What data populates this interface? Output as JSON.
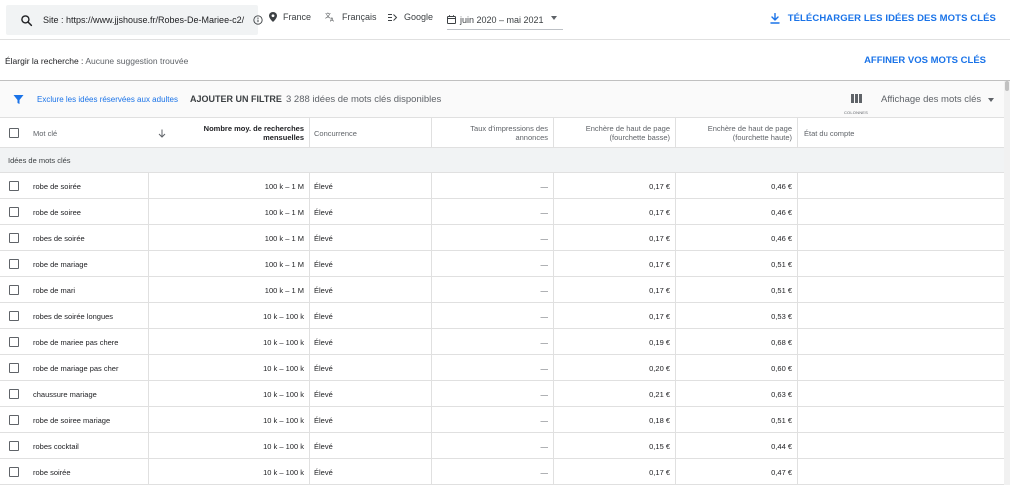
{
  "topbar": {
    "site": "Site : https://www.jjshouse.fr/Robes-De-Mariee-c2/",
    "location": "France",
    "language": "Français",
    "network": "Google",
    "date_range": "juin 2020 – mai 2021",
    "download_label": "TÉLÉCHARGER LES IDÉES DES MOTS CLÉS"
  },
  "broaden": {
    "label": "Élargir la recherche :",
    "value": "Aucune suggestion trouvée",
    "refine_label": "AFFINER VOS MOTS CLÉS"
  },
  "filterbar": {
    "exclude_label": "Exclure les idées réservées aux adultes",
    "add_filter_label": "AJOUTER UN FILTRE",
    "count_label": "3 288 idées de mots clés disponibles",
    "columns_label": "COLONNES",
    "display_label": "Affichage des mots clés"
  },
  "table": {
    "headers": {
      "keyword": "Mot clé",
      "searches": "Nombre moy. de recherches mensuelles",
      "competition": "Concurrence",
      "impressions": "Taux d'impressions des annonces",
      "bid_low": "Enchère de haut de page (fourchette basse)",
      "bid_high": "Enchère de haut de page (fourchette haute)",
      "account": "État du compte"
    },
    "group_label": "Idées de mots clés",
    "rows": [
      {
        "keyword": "robe de soirée",
        "searches": "100 k – 1 M",
        "competition": "Élevé",
        "impressions": "—",
        "bid_low": "0,17 €",
        "bid_high": "0,46 €"
      },
      {
        "keyword": "robe de soiree",
        "searches": "100 k – 1 M",
        "competition": "Élevé",
        "impressions": "—",
        "bid_low": "0,17 €",
        "bid_high": "0,46 €"
      },
      {
        "keyword": "robes de soirée",
        "searches": "100 k – 1 M",
        "competition": "Élevé",
        "impressions": "—",
        "bid_low": "0,17 €",
        "bid_high": "0,46 €"
      },
      {
        "keyword": "robe de mariage",
        "searches": "100 k – 1 M",
        "competition": "Élevé",
        "impressions": "—",
        "bid_low": "0,17 €",
        "bid_high": "0,51 €"
      },
      {
        "keyword": "robe de mari",
        "searches": "100 k – 1 M",
        "competition": "Élevé",
        "impressions": "—",
        "bid_low": "0,17 €",
        "bid_high": "0,51 €"
      },
      {
        "keyword": "robes de soirée longues",
        "searches": "10 k – 100 k",
        "competition": "Élevé",
        "impressions": "—",
        "bid_low": "0,17 €",
        "bid_high": "0,53 €"
      },
      {
        "keyword": "robe de mariee pas chere",
        "searches": "10 k – 100 k",
        "competition": "Élevé",
        "impressions": "—",
        "bid_low": "0,19 €",
        "bid_high": "0,68 €"
      },
      {
        "keyword": "robe de mariage pas cher",
        "searches": "10 k – 100 k",
        "competition": "Élevé",
        "impressions": "—",
        "bid_low": "0,20 €",
        "bid_high": "0,60 €"
      },
      {
        "keyword": "chaussure mariage",
        "searches": "10 k – 100 k",
        "competition": "Élevé",
        "impressions": "—",
        "bid_low": "0,21 €",
        "bid_high": "0,63 €"
      },
      {
        "keyword": "robe de soiree mariage",
        "searches": "10 k – 100 k",
        "competition": "Élevé",
        "impressions": "—",
        "bid_low": "0,18 €",
        "bid_high": "0,51 €"
      },
      {
        "keyword": "robes cocktail",
        "searches": "10 k – 100 k",
        "competition": "Élevé",
        "impressions": "—",
        "bid_low": "0,15 €",
        "bid_high": "0,44 €"
      },
      {
        "keyword": "robe soirée",
        "searches": "10 k – 100 k",
        "competition": "Élevé",
        "impressions": "—",
        "bid_low": "0,17 €",
        "bid_high": "0,47 €"
      }
    ]
  },
  "colors": {
    "accent": "#1a73e8",
    "chip_bg": "#f1f3f4",
    "text": "#202124",
    "muted": "#5f6368",
    "divider": "#e0e0e0"
  },
  "icons": {
    "search": "search-icon",
    "info": "info-icon",
    "location": "location-pin-icon",
    "language": "translate-icon",
    "network": "network-icon",
    "calendar": "calendar-icon",
    "download": "download-icon",
    "filter": "filter-funnel-icon",
    "columns": "columns-icon",
    "sort": "sort-arrow-down-icon"
  }
}
